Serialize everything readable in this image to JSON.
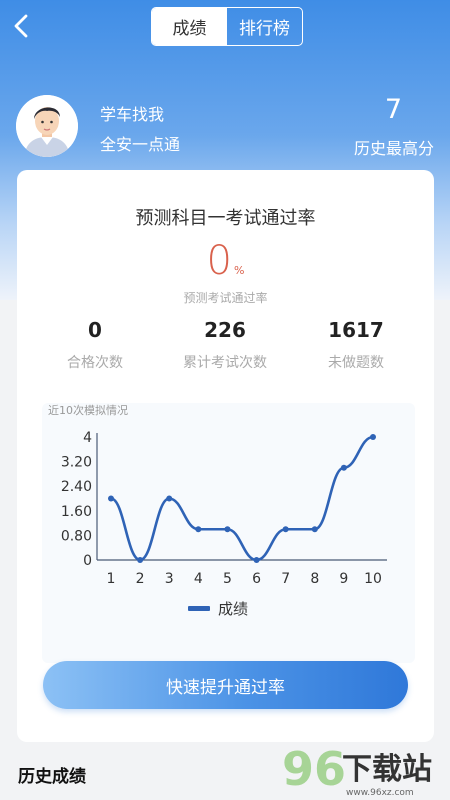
{
  "header": {
    "tabs": [
      {
        "label": "成绩",
        "active": true
      },
      {
        "label": "排行榜",
        "active": false
      }
    ]
  },
  "user": {
    "name": "学车找我",
    "subtitle": "全安一点通",
    "best_score": "7",
    "best_score_label": "历史最高分"
  },
  "card": {
    "title": "预测科目一考试通过率",
    "pass_rate": "0",
    "pass_rate_unit": "%",
    "pass_rate_label": "预测考试通过率",
    "stats": [
      {
        "value": "0",
        "label": "合格次数"
      },
      {
        "value": "226",
        "label": "累计考试次数"
      },
      {
        "value": "1617",
        "label": "未做题数"
      }
    ],
    "cta_label": "快速提升通过率"
  },
  "chart_data": {
    "type": "line",
    "title": "近10次模拟情况",
    "x": [
      1,
      2,
      3,
      4,
      5,
      6,
      7,
      8,
      9,
      10
    ],
    "series": [
      {
        "name": "成绩",
        "values": [
          2,
          0,
          2,
          1,
          1,
          0,
          1,
          1,
          3,
          4
        ],
        "color": "#2f63b6"
      }
    ],
    "y_ticks": [
      "4",
      "3.20",
      "2.40",
      "1.60",
      "0.80",
      "0"
    ],
    "ylim": [
      0,
      4
    ],
    "smooth": true,
    "legend": "bottom-center"
  },
  "history": {
    "title": "历史成绩"
  },
  "watermark": {
    "text": "96下载站",
    "sub": "www.96xz.com"
  }
}
